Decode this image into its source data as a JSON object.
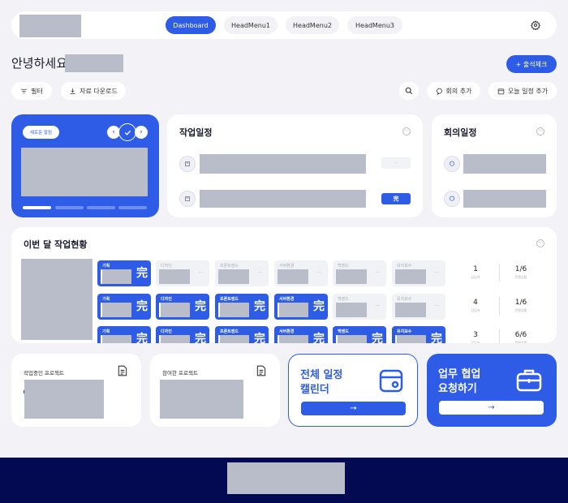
{
  "header": {
    "menus": [
      {
        "label": "Dashboard",
        "active": true
      },
      {
        "label": "HeadMenu1",
        "active": false
      },
      {
        "label": "HeadMenu2",
        "active": false
      },
      {
        "label": "HeadMenu3",
        "active": false
      }
    ],
    "settings_icon": "gear-icon"
  },
  "greeting": "안녕하세요,",
  "attendance_button": "+ 출석체크",
  "toolbar": {
    "filter": "필터",
    "download": "자료 다운로드",
    "add_meeting": "회의 추가",
    "add_today": "오늘 일정 추가"
  },
  "notice": {
    "badge": "새로운 알림",
    "slides": 4
  },
  "work_schedule": {
    "title": "작업일정",
    "rows": [
      {
        "status": "·"
      },
      {
        "status": "完"
      }
    ]
  },
  "meeting_schedule": {
    "title": "회의일정"
  },
  "monthly": {
    "title": "이번 달 작업현황",
    "columns": [
      "기획",
      "디자인",
      "프론트엔드",
      "서버환경",
      "백엔드",
      "유지보수"
    ],
    "rows": [
      {
        "done": [
          true,
          false,
          false,
          false,
          false,
          false
        ],
        "assigned": "1",
        "assigned_label": "담당자",
        "progress": "1/6",
        "progress_label": "진행상황"
      },
      {
        "done": [
          true,
          true,
          true,
          true,
          false,
          false
        ],
        "assigned": "4",
        "assigned_label": "담당자",
        "progress": "1/6",
        "progress_label": "진행상황"
      },
      {
        "done": [
          true,
          true,
          true,
          true,
          true,
          true
        ],
        "assigned": "3",
        "assigned_label": "담당자",
        "progress": "6/6",
        "progress_label": "진행상황"
      }
    ],
    "stamp": "完",
    "empty_mark": "···"
  },
  "bottom": {
    "in_progress": "작업중인 프로젝트",
    "participated": "참여한 프로젝트",
    "calendar_title_1": "전체 일정",
    "calendar_title_2": "캘린더",
    "collab_title_1": "업무 협업",
    "collab_title_2": "요청하기",
    "arrow": "→"
  },
  "colors": {
    "primary": "#2e5ce6",
    "footer": "#040a52",
    "placeholder": "#b9bdc9"
  }
}
